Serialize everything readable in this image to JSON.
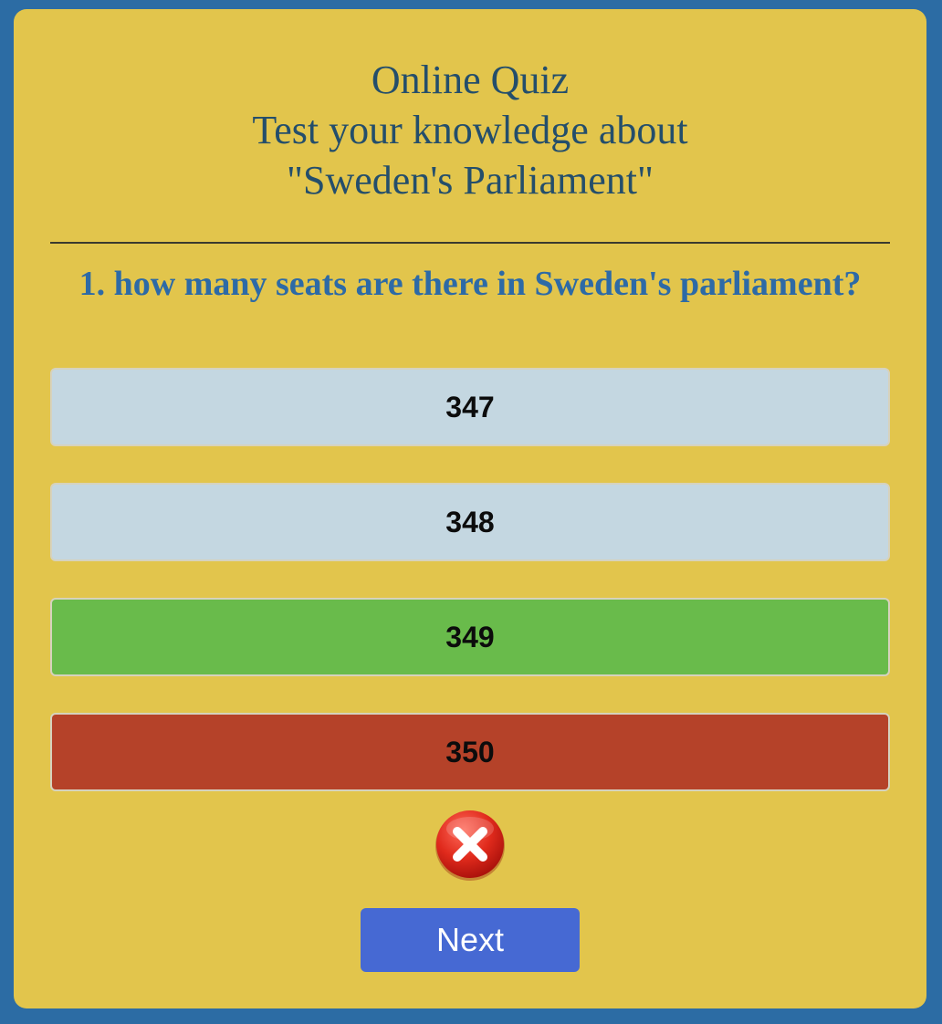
{
  "header": {
    "line1": "Online Quiz",
    "line2": "Test your knowledge about",
    "line3": "\"Sweden's Parliament\""
  },
  "question": {
    "text": "1. how many seats are there in Sweden's parliament?"
  },
  "options": [
    {
      "label": "347",
      "state": "neutral"
    },
    {
      "label": "348",
      "state": "neutral"
    },
    {
      "label": "349",
      "state": "correct"
    },
    {
      "label": "350",
      "state": "wrong"
    }
  ],
  "result": {
    "icon": "cross-mark-icon",
    "status": "incorrect"
  },
  "next_button": {
    "label": "Next"
  },
  "colors": {
    "page_background": "#2c6ca4",
    "card_background": "#e2c54c",
    "header_text": "#244e6b",
    "question_text": "#2d6aa6",
    "option_neutral": "#c4d7e1",
    "option_correct": "#69bb4b",
    "option_wrong": "#b54229",
    "next_button": "#4669d3"
  }
}
